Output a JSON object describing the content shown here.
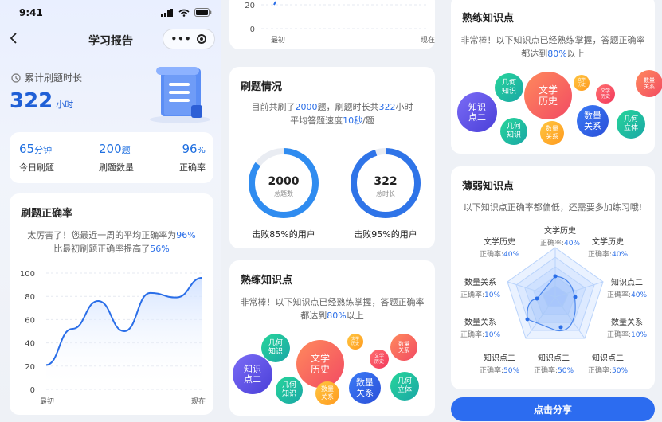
{
  "status": {
    "time": "9:41"
  },
  "nav": {
    "title": "学习报告"
  },
  "summary": {
    "label": "累计刷题时长",
    "value": "322",
    "unit": "小时"
  },
  "stats": [
    {
      "value": "65",
      "unit": "分钟",
      "label": "今日刷题"
    },
    {
      "value": "200",
      "unit": "题",
      "label": "刷题数量"
    },
    {
      "value": "96",
      "unit": "%",
      "label": "正确率"
    }
  ],
  "accuracy": {
    "title": "刷题正确率",
    "line1_pre": "太厉害了！您最近一周的平均正确率为",
    "line1_val": "96%",
    "line2_pre": "比最初刷题正确率提高了",
    "line2_val": "56%"
  },
  "chart_data": {
    "type": "line",
    "categories": [
      "最初",
      "",
      "",
      "",
      "",
      "",
      "现在"
    ],
    "ylim": [
      0,
      100
    ],
    "yticks": [
      0,
      20,
      40,
      60,
      80,
      100
    ],
    "xticks": [
      "最初",
      "现在"
    ],
    "values": [
      21,
      52,
      76,
      50,
      83,
      79,
      96
    ],
    "color": "#2a6ee8"
  },
  "mini_chart": {
    "yticks": [
      "20",
      "0"
    ],
    "xticks": [
      "最初",
      "现在"
    ]
  },
  "practice": {
    "title": "刷题情况",
    "line1_pre": "目前共刷了",
    "count": "2000",
    "line1_mid": "题，刷题时长共",
    "hours": "322",
    "line1_post": "小时",
    "line2_pre": "平均答题速度",
    "speed": "10秒",
    "line2_post": "/题",
    "rings": [
      {
        "value": "2000",
        "sub": "总题数",
        "beat": "击败85%的用户",
        "percent": 85,
        "color": "#2f8cf0"
      },
      {
        "value": "322",
        "sub": "总时长",
        "beat": "击败95%的用户",
        "percent": 95,
        "color": "#2f74e8"
      }
    ]
  },
  "mastered": {
    "title": "熟练知识点",
    "line1": "非常棒！以下知识点已经熟练掌握，答题正确率",
    "line2_pre": "都达到",
    "line2_val": "80%",
    "line2_post": "以上",
    "bubbles": [
      "几何知识",
      "文学历史",
      "数量关系",
      "文学历史",
      "文学历史",
      "知识点二",
      "几何知识",
      "数量关系",
      "数量关系",
      "几何立体"
    ]
  },
  "weak": {
    "title": "薄弱知识点",
    "desc": "以下知识点正确率都偏低，还需要多加练习哦!",
    "rate_label": "正确率:",
    "labels": [
      {
        "name": "文学历史",
        "rate": "40%"
      },
      {
        "name": "文学历史",
        "rate": "40%"
      },
      {
        "name": "文学历史",
        "rate": "40%"
      },
      {
        "name": "数量关系",
        "rate": "10%"
      },
      {
        "name": "知识点二",
        "rate": "40%"
      },
      {
        "name": "数量关系",
        "rate": "10%"
      },
      {
        "name": "数量关系",
        "rate": "10%"
      },
      {
        "name": "知识点二",
        "rate": "50%"
      },
      {
        "name": "知识点二",
        "rate": "50%"
      },
      {
        "name": "知识点二",
        "rate": "50%"
      }
    ]
  },
  "share": {
    "label": "点击分享"
  }
}
